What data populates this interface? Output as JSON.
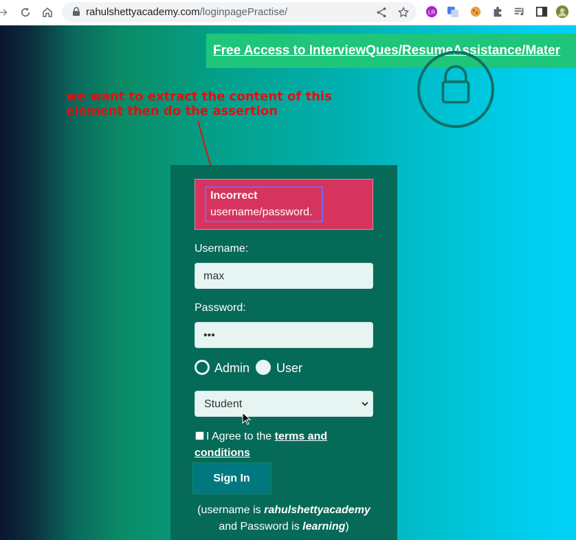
{
  "browser": {
    "url_host": "rahulshettyacademy.com",
    "url_path": "/loginpagePractise/"
  },
  "page": {
    "banner_link": "Free Access to InterviewQues/ResumeAssistance/Mater",
    "annotation": "we want to extract the content of this element then do the assertion",
    "alert": {
      "title": "Incorrect",
      "message": "username/password."
    },
    "form": {
      "username_label": "Username:",
      "username_value": "max",
      "password_label": "Password:",
      "password_value": "•••",
      "radio_admin": "Admin",
      "radio_user": "User",
      "select_value": "Student",
      "terms_prefix": "I Agree to the",
      "terms_link": "terms and conditions",
      "signin_label": "Sign In"
    },
    "hint": {
      "part1": "(username is",
      "username": "rahulshettyacademy",
      "part2": "and Password is",
      "password": "learning",
      "part3": ")"
    }
  },
  "colors": {
    "panel": "#066a58",
    "alert": "#d6345f",
    "banner": "#1ec57a",
    "annotation": "#e01010"
  }
}
